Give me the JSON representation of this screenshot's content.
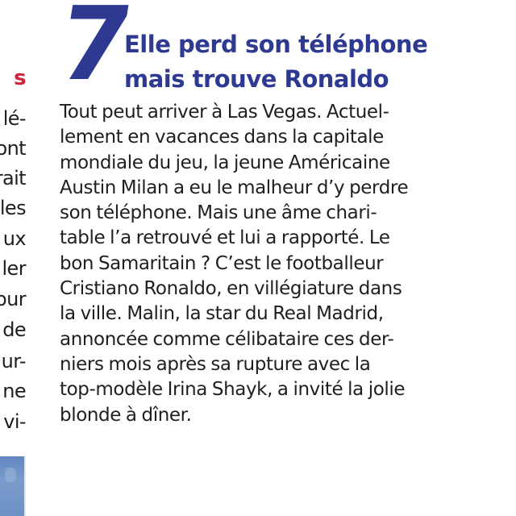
{
  "article": {
    "number": "7",
    "headline": [
      "Elle perd son téléphone",
      "mais trouve Ronaldo"
    ],
    "body_lines": [
      "Tout peut arriver à Las Vegas. Actuel-",
      "lement en vacances dans la capitale",
      "mondiale du jeu, la jeune Américaine",
      "Austin Milan a eu le malheur d’y perdre",
      "son téléphone. Mais une âme chari-",
      "table l’a retrouvé et lui a rapporté. Le",
      "bon Samaritain ? C’est le footballeur",
      "Cristiano Ronaldo, en villégiature dans",
      "la ville. Malin, la star du Real Madrid,",
      "annoncée comme célibataire ces der-",
      "niers mois après sa rupture avec la",
      "top-modèle Irina Shayk, a invité la jolie",
      "blonde à dîner."
    ]
  },
  "left_column": {
    "heading_fragment": "s",
    "fragments": [
      "lé-",
      "ont",
      "rait",
      "les",
      "ux",
      "ler",
      "our",
      "de",
      "ur-",
      "ne",
      "vi-"
    ]
  },
  "colors": {
    "accent_blue": "#2e3a91",
    "accent_red": "#d5203b",
    "text": "#1f1f1f"
  }
}
